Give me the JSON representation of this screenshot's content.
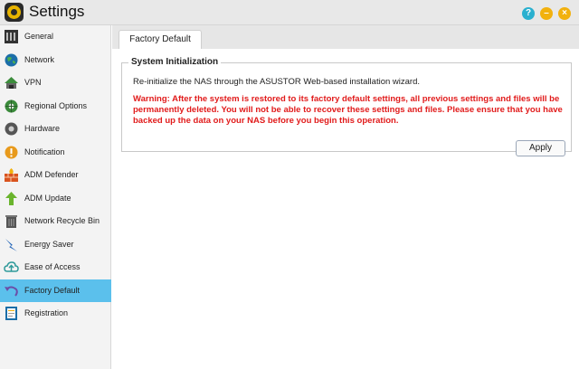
{
  "window": {
    "title": "Settings"
  },
  "sidebar": {
    "items": [
      {
        "label": "General",
        "icon": "general-icon"
      },
      {
        "label": "Network",
        "icon": "network-globe-icon"
      },
      {
        "label": "VPN",
        "icon": "vpn-icon"
      },
      {
        "label": "Regional Options",
        "icon": "regional-options-icon"
      },
      {
        "label": "Hardware",
        "icon": "hardware-icon"
      },
      {
        "label": "Notification",
        "icon": "notification-icon"
      },
      {
        "label": "ADM Defender",
        "icon": "firewall-icon"
      },
      {
        "label": "ADM Update",
        "icon": "update-arrow-icon"
      },
      {
        "label": "Network Recycle Bin",
        "icon": "recycle-bin-icon"
      },
      {
        "label": "Energy Saver",
        "icon": "energy-saver-icon"
      },
      {
        "label": "Ease of Access",
        "icon": "cloud-upload-icon"
      },
      {
        "label": "Factory Default",
        "icon": "factory-default-icon",
        "active": true
      },
      {
        "label": "Registration",
        "icon": "registration-icon"
      }
    ]
  },
  "tabs": [
    {
      "label": "Factory Default"
    }
  ],
  "section": {
    "title": "System Initialization",
    "description": "Re-initialize the NAS through the ASUSTOR Web-based installation wizard.",
    "warning": "Warning: After the system is restored to its factory default settings, all previous settings and files will be permanently deleted. You will not be able to recover these settings and files. Please ensure that you have backed up the data on your NAS before you begin this operation."
  },
  "buttons": {
    "apply": "Apply"
  },
  "colors": {
    "active_sidebar": "#5bc0ec",
    "warning_text": "#e11b1b",
    "help_button": "#2ab0cf",
    "window_buttons": "#f2b10e"
  }
}
